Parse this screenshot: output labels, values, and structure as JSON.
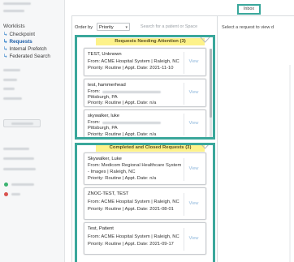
{
  "sidebar": {
    "section_title": "Worklists",
    "items": [
      {
        "label": "Checkpoint",
        "active": false
      },
      {
        "label": "Requests",
        "active": true
      },
      {
        "label": "Internal Prefetch",
        "active": false
      },
      {
        "label": "Federated Search",
        "active": false
      }
    ],
    "status_colors": [
      "#3cb371",
      "#d9534f"
    ]
  },
  "header": {
    "inbox_tab": "Inbox"
  },
  "toolbar": {
    "order_label": "Order by",
    "order_value": "Priority",
    "search_placeholder": "Search for a patient or Space"
  },
  "detail": {
    "hint": "Select a request to view d"
  },
  "groups": {
    "attention": {
      "title": "Requests Needing Attention (3)",
      "cards": [
        {
          "name": "TEST, Unknown",
          "from": "From: ACME Hospital System | Raleigh, NC",
          "meta": "Priority: Routine | Appt. Date: 2021-11-10",
          "view": "View"
        },
        {
          "name": "test, hammerhead",
          "from": "From:",
          "location": "Pittsburgh, PA",
          "meta": "Priority: Routine | Appt. Date: n/a",
          "view": "View"
        },
        {
          "name": "skywalker, luke",
          "from": "From:",
          "location": "Pittsburgh, PA",
          "meta": "Priority: Routine | Appt. Date: n/a",
          "view": "View"
        }
      ]
    },
    "closed": {
      "title": "Completed and Closed Requests (3)",
      "cards": [
        {
          "name": "Skywalker, Luke",
          "from": "From: Medicom Regional Healthcare System",
          "from2": "- Images | Raleigh, NC",
          "meta": "Priority: Routine | Appt. Date: n/a",
          "view": "View"
        },
        {
          "name": "ZNOC-TEST, TEST",
          "from": "From: ACME Hospital System | Raleigh, NC",
          "meta": "Priority: Routine | Appt. Date: 2021-08-01",
          "view": "View"
        },
        {
          "name": "Test, Patient",
          "from": "From: ACME Hospital System | Raleigh, NC",
          "meta": "Priority: Routine | Appt. Date: 2021-09-17",
          "view": "View"
        }
      ]
    }
  },
  "colors": {
    "highlight": "#3aa79b",
    "header_bg": "#fdf28a",
    "link": "#8fb7dc"
  }
}
